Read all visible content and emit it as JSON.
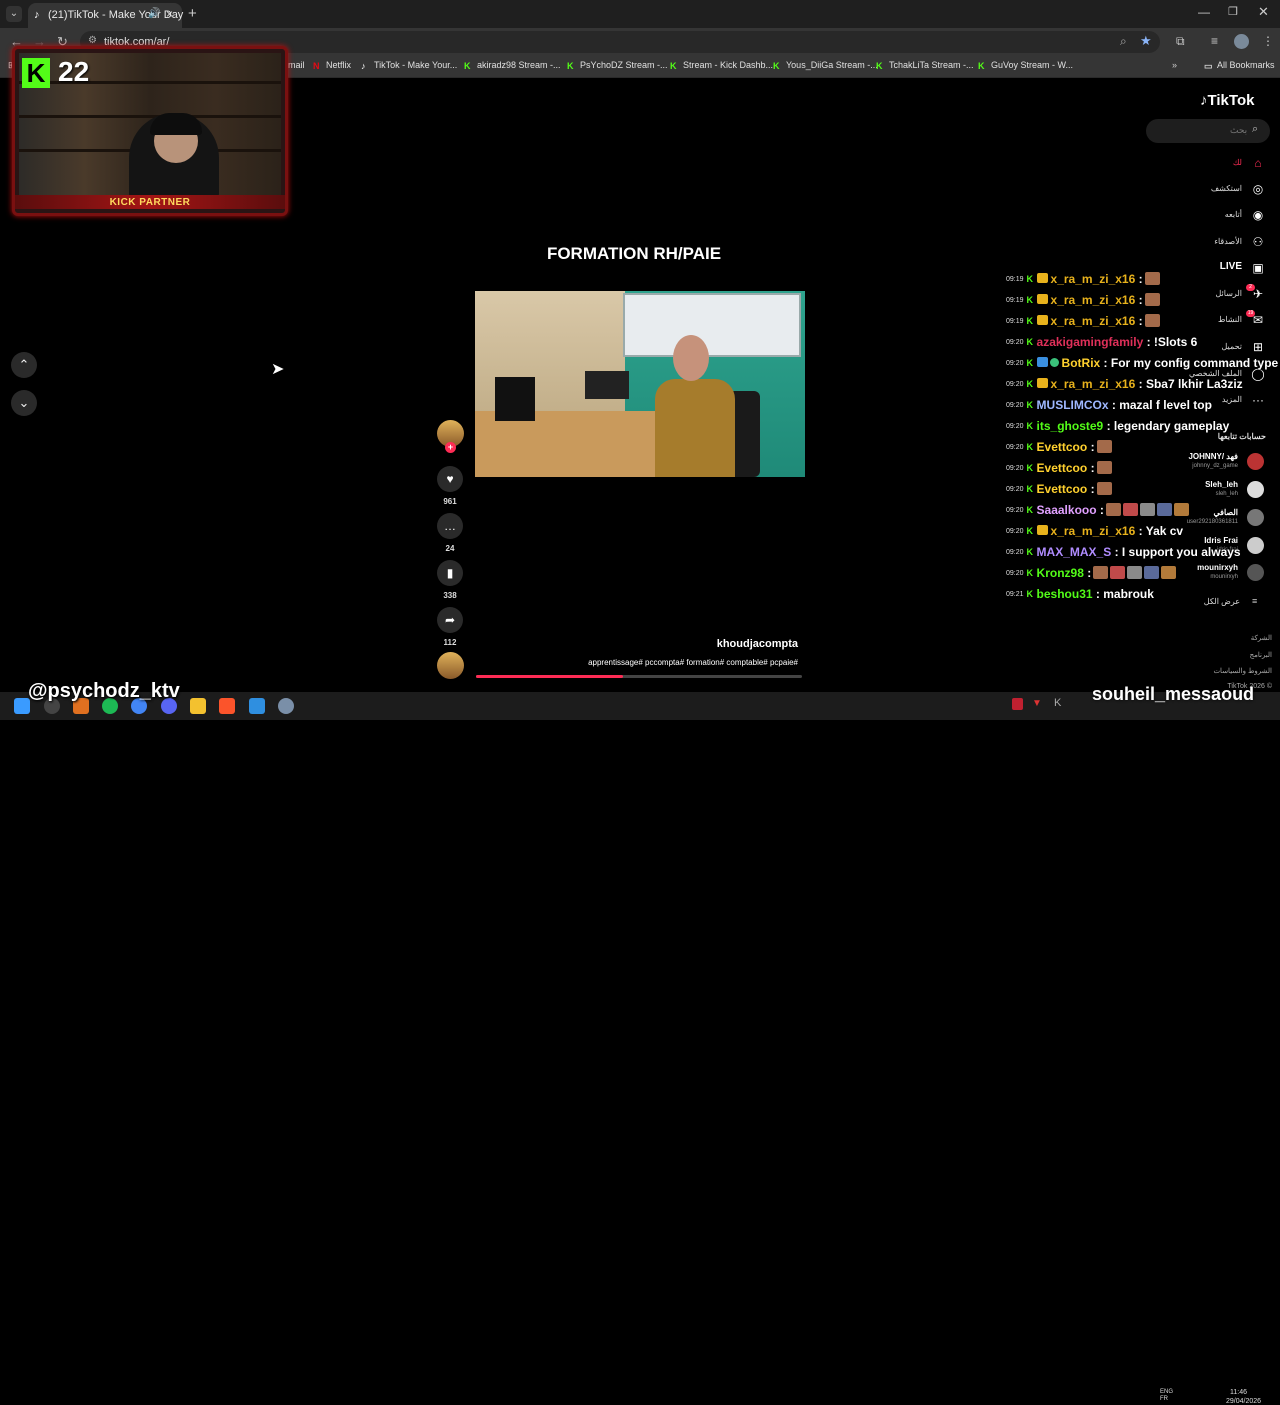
{
  "browser": {
    "tab_title": "(21)TikTok - Make Your Day",
    "url": "tiktok.com/ar/",
    "bookmarks": [
      {
        "label": "Gmail",
        "icon": "gmail-icon",
        "color": "#ea4335"
      },
      {
        "label": "Netflix",
        "icon": "netflix-icon",
        "color": "#e50914"
      },
      {
        "label": "TikTok - Make Your...",
        "icon": "tiktok-icon",
        "color": "#ffffff"
      },
      {
        "label": "akiradz98 Stream -...",
        "icon": "kick-icon",
        "color": "#53fc18"
      },
      {
        "label": "PsYchoDZ Stream -...",
        "icon": "kick-icon",
        "color": "#53fc18"
      },
      {
        "label": "Stream - Kick Dashb...",
        "icon": "kick-icon",
        "color": "#53fc18"
      },
      {
        "label": "Yous_DiiGa Stream -...",
        "icon": "kick-icon",
        "color": "#53fc18"
      },
      {
        "label": "TchakLiTa Stream -...",
        "icon": "kick-icon",
        "color": "#53fc18"
      },
      {
        "label": "GuVoy Stream - W...",
        "icon": "kick-icon",
        "color": "#53fc18"
      }
    ],
    "all_bookmarks": "All Bookmarks"
  },
  "overlay": {
    "viewer_count": "22",
    "kick_partner": "KICK PARTNER",
    "handle_left": "@psychodz_ktv",
    "handle_right": "souheil_messaoud"
  },
  "video": {
    "title": "FORMATION RH/PAIE",
    "author": "khoudjacompta",
    "hashtags": "apprentissage# pccompta# formation# comptable# pcpaie#",
    "progress": 0.45
  },
  "actions": {
    "likes": "961",
    "comments": "24",
    "saves": "338",
    "shares": "112"
  },
  "tiktok": {
    "logo": "TikTok",
    "search_placeholder": "بحث",
    "nav": [
      {
        "label": "لك",
        "icon": "home-icon"
      },
      {
        "label": "استكشف",
        "icon": "compass-icon"
      },
      {
        "label": "أتابعه",
        "icon": "following-icon"
      },
      {
        "label": "الأصدقاء",
        "icon": "friends-icon"
      },
      {
        "label": "LIVE",
        "icon": "live-icon"
      },
      {
        "label": "الرسائل",
        "icon": "messages-icon",
        "badge": "2"
      },
      {
        "label": "النشاط",
        "icon": "activity-icon",
        "badge": "19"
      },
      {
        "label": "تحميل",
        "icon": "upload-icon"
      },
      {
        "label": "الملف الشخصي",
        "icon": "profile-icon"
      },
      {
        "label": "المزيد",
        "icon": "more-icon"
      }
    ],
    "following_heading": "حسابات تتابعها",
    "following": [
      {
        "name": "JOHNNY/ فهد",
        "handle": "johnny_dz_game"
      },
      {
        "name": "Sleh_leh",
        "handle": "sleh_leh"
      },
      {
        "name": "الصافي",
        "handle": "user292180361811"
      },
      {
        "name": "Idris Frai",
        "handle": "idris.frai"
      },
      {
        "name": "mounirxyh",
        "handle": "mounirxyh"
      }
    ],
    "see_all": "عرض الكل",
    "footer": [
      "الشركة",
      "البرنامج",
      "الشروط والسياسات",
      "TikTok 2026 ©"
    ]
  },
  "chat": [
    {
      "time": "09:19",
      "user": "x_ra_m_zi_x16",
      "color": "#e8b21c",
      "badge": "sub",
      "msg": ":",
      "emotes": 1
    },
    {
      "time": "09:19",
      "user": "x_ra_m_zi_x16",
      "color": "#e8b21c",
      "badge": "sub",
      "msg": ":",
      "emotes": 1
    },
    {
      "time": "09:19",
      "user": "x_ra_m_zi_x16",
      "color": "#e8b21c",
      "badge": "sub",
      "msg": ":",
      "emotes": 1
    },
    {
      "time": "09:20",
      "user": "azakigamingfamily",
      "color": "#e0305a",
      "badge": "",
      "msg": ": !Slots 6",
      "emotes": 0
    },
    {
      "time": "09:20",
      "user": "BotRix",
      "color": "#ffd12e",
      "badge": "bot",
      "msg": ": For my config command type !con",
      "emotes": 0
    },
    {
      "time": "09:20",
      "user": "x_ra_m_zi_x16",
      "color": "#e8b21c",
      "badge": "sub",
      "msg": ": Sba7 lkhir La3ziz",
      "emotes": 0
    },
    {
      "time": "09:20",
      "user": "MUSLIMCOx",
      "color": "#9fb8ff",
      "badge": "",
      "msg": ": mazal f level top",
      "emotes": 0
    },
    {
      "time": "09:20",
      "user": "its_ghoste9",
      "color": "#53fc18",
      "badge": "",
      "msg": ": legendary gameplay",
      "emotes": 0
    },
    {
      "time": "09:20",
      "user": "Evettcoo",
      "color": "#ffd12e",
      "badge": "",
      "msg": ":",
      "emotes": 1
    },
    {
      "time": "09:20",
      "user": "Evettcoo",
      "color": "#ffd12e",
      "badge": "",
      "msg": ":",
      "emotes": 1
    },
    {
      "time": "09:20",
      "user": "Evettcoo",
      "color": "#ffd12e",
      "badge": "",
      "msg": ":",
      "emotes": 1
    },
    {
      "time": "09:20",
      "user": "Saaalkooo",
      "color": "#e0a0ff",
      "badge": "",
      "msg": ":",
      "emotes": 5
    },
    {
      "time": "09:20",
      "user": "x_ra_m_zi_x16",
      "color": "#e8b21c",
      "badge": "sub",
      "msg": ": Yak cv",
      "emotes": 0
    },
    {
      "time": "09:20",
      "user": "MAX_MAX_S",
      "color": "#b08cff",
      "badge": "",
      "msg": ": I support you always",
      "emotes": 0
    },
    {
      "time": "09:20",
      "user": "Kronz98",
      "color": "#53fc18",
      "badge": "",
      "msg": ":",
      "emotes": 5
    },
    {
      "time": "09:21",
      "user": "beshou31",
      "color": "#53fc18",
      "badge": "",
      "msg": ": mabrouk",
      "emotes": 0
    }
  ],
  "taskbar": {
    "lang": "ENG\nFR",
    "time": "11:46",
    "date": "29/04/2026",
    "apps": [
      {
        "icon": "windows-start-icon",
        "color": "#3a9bff"
      },
      {
        "icon": "obs-icon",
        "color": "#444444"
      },
      {
        "icon": "app-orange-icon",
        "color": "#e07020"
      },
      {
        "icon": "spotify-icon",
        "color": "#1db954"
      },
      {
        "icon": "chrome-icon",
        "color": "#4285f4"
      },
      {
        "icon": "discord-icon",
        "color": "#5865f2"
      },
      {
        "icon": "folder-icon",
        "color": "#f3c12f"
      },
      {
        "icon": "brave-icon",
        "color": "#fb542b"
      },
      {
        "icon": "photos-icon",
        "color": "#2f8fe0"
      },
      {
        "icon": "settings-icon",
        "color": "#7a8fa8"
      }
    ]
  }
}
